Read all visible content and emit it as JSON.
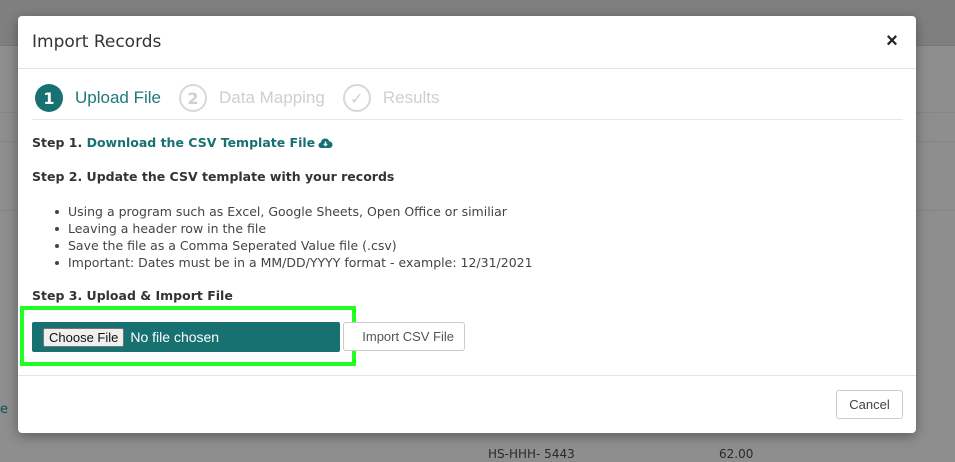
{
  "modal": {
    "title": "Import Records",
    "close_symbol": "×",
    "steps": [
      {
        "number": "1",
        "label": "Upload File",
        "state": "active"
      },
      {
        "number": "2",
        "label": "Data Mapping",
        "state": "inactive"
      },
      {
        "number": "✓",
        "label": "Results",
        "state": "inactive"
      }
    ],
    "step1": {
      "prefix": "Step 1. ",
      "link_text": "Download the CSV Template File",
      "icon": "cloud-download-icon"
    },
    "step2": {
      "heading": "Step 2. Update the CSV template with your records",
      "bullets": [
        "Using a program such as Excel, Google Sheets, Open Office or similiar",
        "Leaving a header row in the file",
        "Save the file as a Comma Seperated Value file (.csv)",
        "Important: Dates must be in a MM/DD/YYYY format - example: 12/31/2021"
      ]
    },
    "step3": {
      "heading": "Step 3. Upload & Import File",
      "choose_file_label": "Choose File",
      "no_file_text": "No file chosen",
      "import_button": "Import CSV File"
    },
    "cancel_button": "Cancel"
  },
  "background": {
    "row_code": "HS-HHH- 5443",
    "row_amount": "62.00",
    "left_link": "e"
  },
  "colors": {
    "accent": "#177170",
    "highlight": "#22ff22"
  }
}
